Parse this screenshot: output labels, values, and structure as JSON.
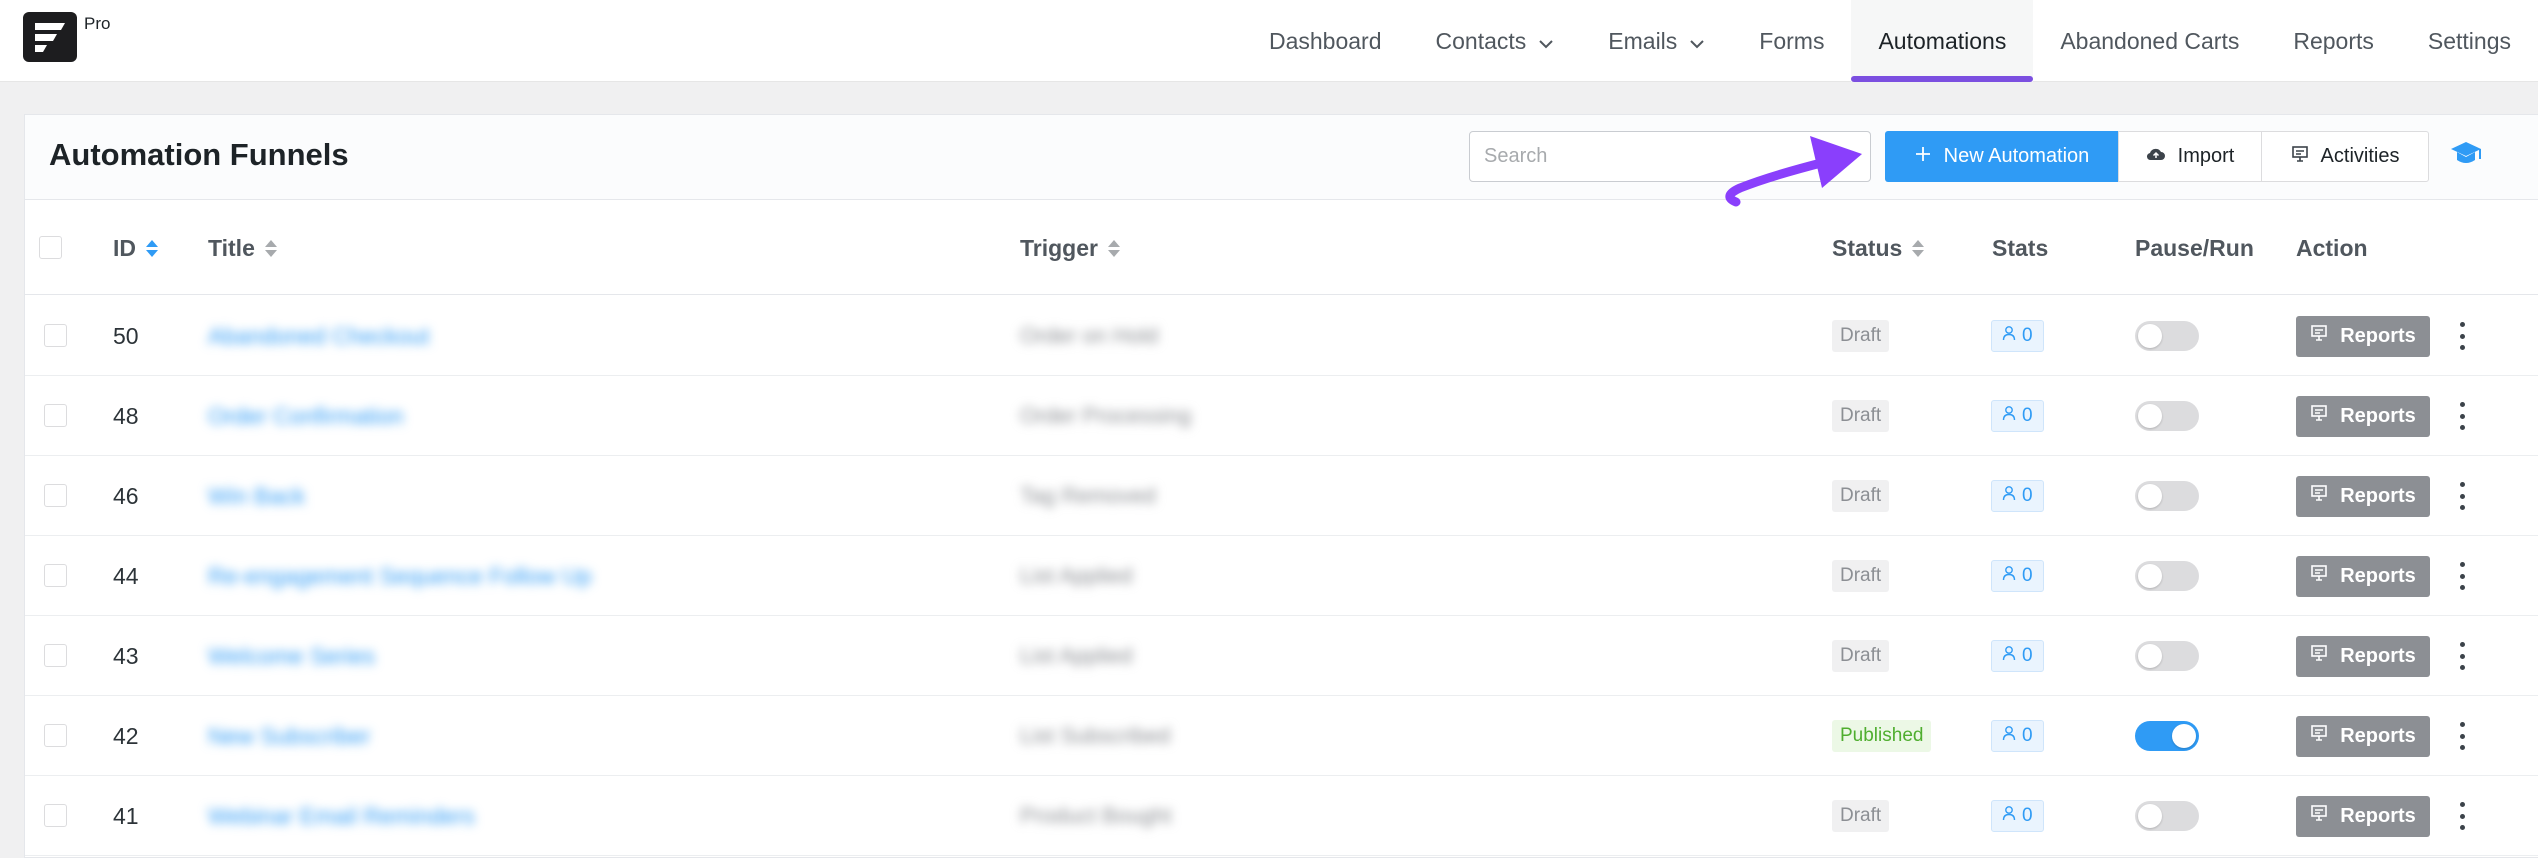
{
  "brand": {
    "badge": "Pro"
  },
  "nav": [
    {
      "label": "Dashboard",
      "dropdown": false,
      "active": false
    },
    {
      "label": "Contacts",
      "dropdown": true,
      "active": false
    },
    {
      "label": "Emails",
      "dropdown": true,
      "active": false
    },
    {
      "label": "Forms",
      "dropdown": false,
      "active": false
    },
    {
      "label": "Automations",
      "dropdown": false,
      "active": true
    },
    {
      "label": "Abandoned Carts",
      "dropdown": false,
      "active": false
    },
    {
      "label": "Reports",
      "dropdown": false,
      "active": false
    },
    {
      "label": "Settings",
      "dropdown": false,
      "active": false
    }
  ],
  "page": {
    "title": "Automation Funnels"
  },
  "toolbar": {
    "search_placeholder": "Search",
    "new_label": "New Automation",
    "import_label": "Import",
    "activities_label": "Activities"
  },
  "columns": {
    "id": "ID",
    "title": "Title",
    "trigger": "Trigger",
    "status": "Status",
    "stats": "Stats",
    "pause_run": "Pause/Run",
    "action": "Action"
  },
  "rows": [
    {
      "id": "50",
      "title": "Abandoned Checkout",
      "trigger": "Order on Hold",
      "status": "Draft",
      "stats": "0",
      "running": false
    },
    {
      "id": "48",
      "title": "Order Confirmation",
      "trigger": "Order Processing",
      "status": "Draft",
      "stats": "0",
      "running": false
    },
    {
      "id": "46",
      "title": "Win Back",
      "trigger": "Tag Removed",
      "status": "Draft",
      "stats": "0",
      "running": false
    },
    {
      "id": "44",
      "title": "Re-engagement Sequence Follow Up",
      "trigger": "List Applied",
      "status": "Draft",
      "stats": "0",
      "running": false
    },
    {
      "id": "43",
      "title": "Welcome Series",
      "trigger": "List Applied",
      "status": "Draft",
      "stats": "0",
      "running": false
    },
    {
      "id": "42",
      "title": "New Subscriber",
      "trigger": "List Subscribed",
      "status": "Published",
      "stats": "0",
      "running": true
    },
    {
      "id": "41",
      "title": "Webinar Email Reminders",
      "trigger": "Product Bought",
      "status": "Draft",
      "stats": "0",
      "running": false
    }
  ],
  "row_action_label": "Reports",
  "colors": {
    "primary": "#2f9bf5",
    "accent": "#7b4fe0",
    "published": "#4fae2f"
  }
}
